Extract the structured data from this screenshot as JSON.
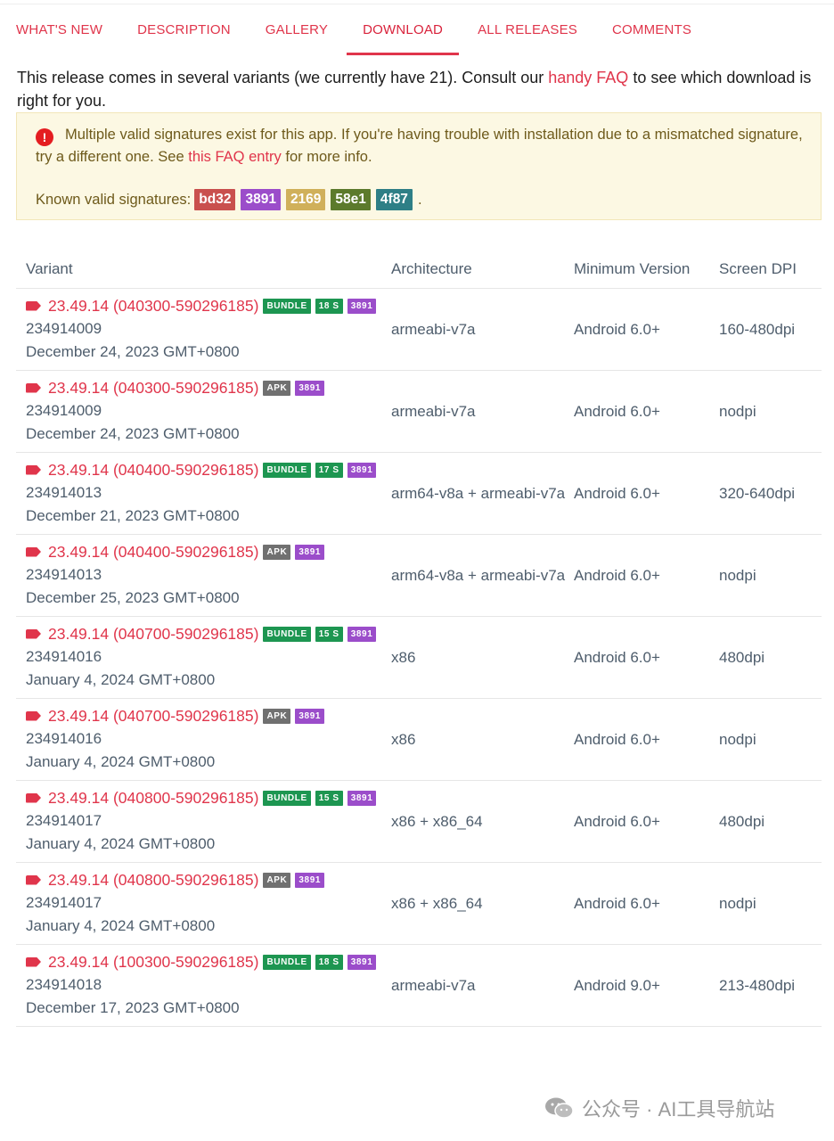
{
  "tabs": [
    {
      "label": "WHAT'S NEW",
      "active": false
    },
    {
      "label": "DESCRIPTION",
      "active": false
    },
    {
      "label": "GALLERY",
      "active": false
    },
    {
      "label": "DOWNLOAD",
      "active": true
    },
    {
      "label": "ALL RELEASES",
      "active": false
    },
    {
      "label": "COMMENTS",
      "active": false
    }
  ],
  "intro": {
    "before": "This release comes in several variants (we currently have 21). Consult our ",
    "link": "handy FAQ",
    "after": " to see which download is right for you."
  },
  "alert": {
    "icon": "exclamation-icon",
    "text_before": "Multiple valid signatures exist for this app. If you're having trouble with installation due to a mismatched signature, try a different one. See ",
    "link": "this FAQ entry",
    "text_after": " for more info.",
    "sig_label": "Known valid signatures: ",
    "signatures": [
      {
        "code": "bd32",
        "color": "#c9504e"
      },
      {
        "code": "3891",
        "color": "#9b4dca"
      },
      {
        "code": "2169",
        "color": "#d0b05a"
      },
      {
        "code": "58e1",
        "color": "#5c7a2c"
      },
      {
        "code": "4f87",
        "color": "#2e7f86"
      }
    ],
    "sig_end": "."
  },
  "table": {
    "headers": {
      "variant": "Variant",
      "arch": "Architecture",
      "minver": "Minimum Version",
      "dpi": "Screen DPI"
    },
    "rows": [
      {
        "version": "23.49.14 (040300-590296185)",
        "type": "BUNDLE",
        "size": "18 S",
        "sig": "3891",
        "code": "234914009",
        "date": "December 24, 2023 GMT+0800",
        "arch": "armeabi-v7a",
        "minver": "Android 6.0+",
        "dpi": "160-480dpi"
      },
      {
        "version": "23.49.14 (040300-590296185)",
        "type": "APK",
        "size": "",
        "sig": "3891",
        "code": "234914009",
        "date": "December 24, 2023 GMT+0800",
        "arch": "armeabi-v7a",
        "minver": "Android 6.0+",
        "dpi": "nodpi"
      },
      {
        "version": "23.49.14 (040400-590296185)",
        "type": "BUNDLE",
        "size": "17 S",
        "sig": "3891",
        "code": "234914013",
        "date": "December 21, 2023 GMT+0800",
        "arch": "arm64-v8a + armeabi-v7a",
        "minver": "Android 6.0+",
        "dpi": "320-640dpi"
      },
      {
        "version": "23.49.14 (040400-590296185)",
        "type": "APK",
        "size": "",
        "sig": "3891",
        "code": "234914013",
        "date": "December 25, 2023 GMT+0800",
        "arch": "arm64-v8a + armeabi-v7a",
        "minver": "Android 6.0+",
        "dpi": "nodpi"
      },
      {
        "version": "23.49.14 (040700-590296185)",
        "type": "BUNDLE",
        "size": "15 S",
        "sig": "3891",
        "code": "234914016",
        "date": "January 4, 2024 GMT+0800",
        "arch": "x86",
        "minver": "Android 6.0+",
        "dpi": "480dpi"
      },
      {
        "version": "23.49.14 (040700-590296185)",
        "type": "APK",
        "size": "",
        "sig": "3891",
        "code": "234914016",
        "date": "January 4, 2024 GMT+0800",
        "arch": "x86",
        "minver": "Android 6.0+",
        "dpi": "nodpi"
      },
      {
        "version": "23.49.14 (040800-590296185)",
        "type": "BUNDLE",
        "size": "15 S",
        "sig": "3891",
        "code": "234914017",
        "date": "January 4, 2024 GMT+0800",
        "arch": "x86 + x86_64",
        "minver": "Android 6.0+",
        "dpi": "480dpi"
      },
      {
        "version": "23.49.14 (040800-590296185)",
        "type": "APK",
        "size": "",
        "sig": "3891",
        "code": "234914017",
        "date": "January 4, 2024 GMT+0800",
        "arch": "x86 + x86_64",
        "minver": "Android 6.0+",
        "dpi": "nodpi"
      },
      {
        "version": "23.49.14 (100300-590296185)",
        "type": "BUNDLE",
        "size": "18 S",
        "sig": "3891",
        "code": "234914018",
        "date": "December 17, 2023 GMT+0800",
        "arch": "armeabi-v7a",
        "minver": "Android 9.0+",
        "dpi": "213-480dpi"
      }
    ]
  },
  "watermark": {
    "icon": "wechat-icon",
    "text": "公众号 · AI工具导航站"
  }
}
